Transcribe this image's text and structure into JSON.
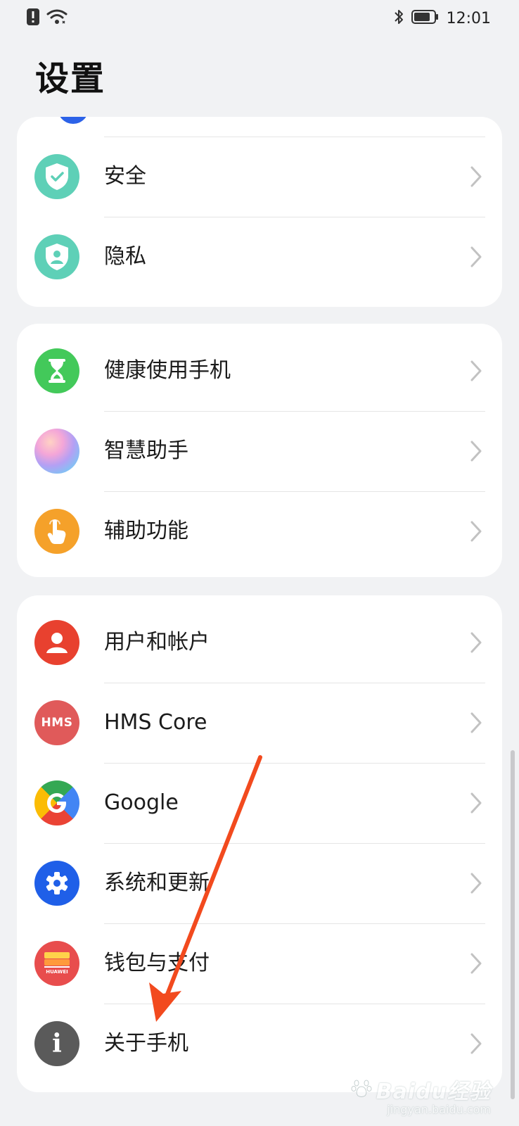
{
  "status_bar": {
    "time": "12:01",
    "icons": [
      "alert-icon",
      "wifi-icon",
      "bluetooth-icon",
      "battery-icon"
    ]
  },
  "page": {
    "title": "设置"
  },
  "groups": [
    {
      "items": [
        {
          "label": "安全",
          "icon": "shield-check-icon",
          "color": "#5ed0b7"
        },
        {
          "label": "隐私",
          "icon": "privacy-shield-icon",
          "color": "#5ed0b7"
        }
      ]
    },
    {
      "items": [
        {
          "label": "健康使用手机",
          "icon": "hourglass-icon",
          "color": "#43c95a"
        },
        {
          "label": "智慧助手",
          "icon": "assistant-orb-icon",
          "color": "#c9a5f0"
        },
        {
          "label": "辅助功能",
          "icon": "hand-pointer-icon",
          "color": "#f5a12a"
        }
      ]
    },
    {
      "items": [
        {
          "label": "用户和帐户",
          "icon": "user-icon",
          "color": "#e8412f"
        },
        {
          "label": "HMS Core",
          "icon": "hms-icon",
          "color": "#e05a5a",
          "icon_text": "HMS"
        },
        {
          "label": "Google",
          "icon": "google-icon",
          "color": "#4285f4"
        },
        {
          "label": "系统和更新",
          "icon": "gear-icon",
          "color": "#1f5fe8"
        },
        {
          "label": "钱包与支付",
          "icon": "wallet-icon",
          "color": "#e84d4d",
          "icon_text": "HUAWEI"
        },
        {
          "label": "关于手机",
          "icon": "info-icon",
          "color": "#5a5a5a",
          "icon_text": "i"
        }
      ]
    }
  ],
  "watermark": {
    "text": "Baidu经验",
    "sub": "jingyan.baidu.com"
  }
}
